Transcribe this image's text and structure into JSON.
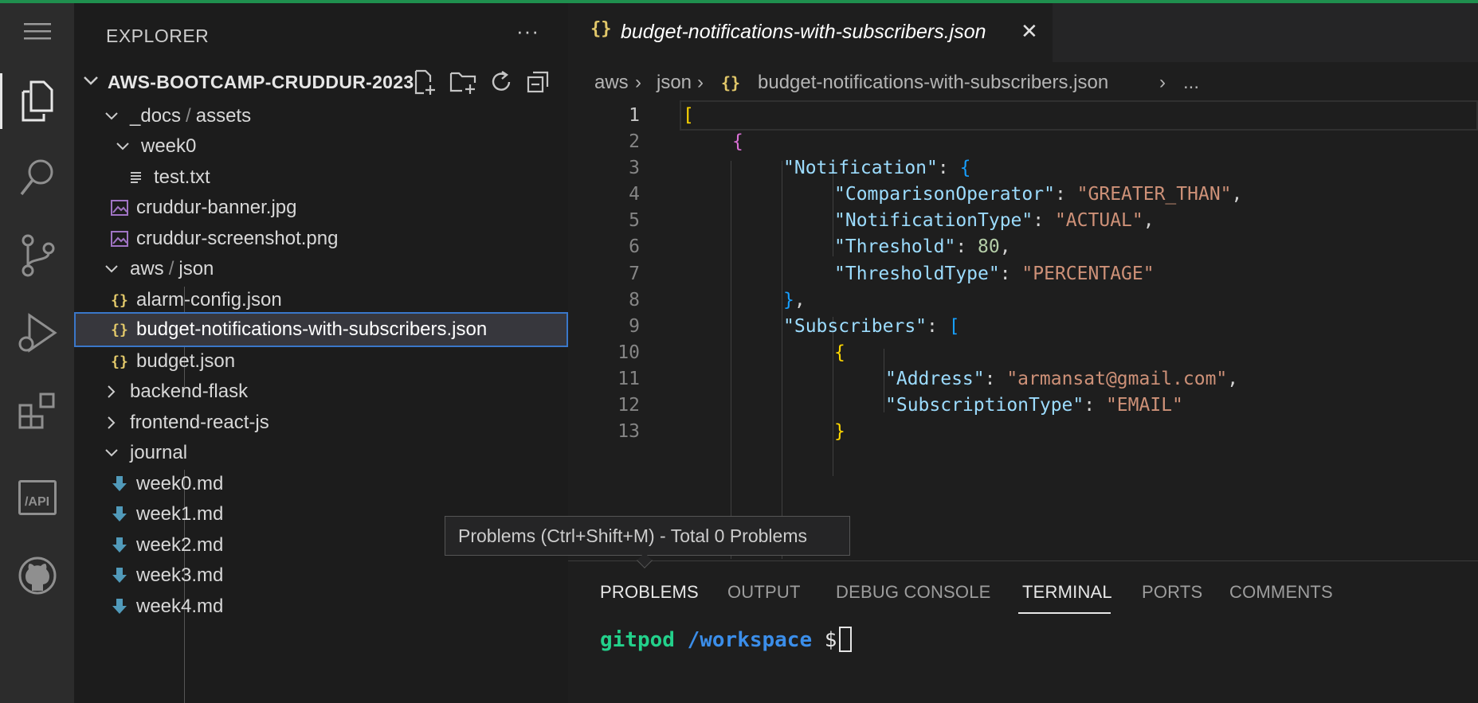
{
  "explorer": {
    "title": "EXPLORER",
    "more_label": "···",
    "folder_name": "AWS-BOOTCAMP-CRUDDUR-2023",
    "tree": [
      {
        "parts": [
          "_docs",
          "assets"
        ],
        "type": "folder-open"
      },
      {
        "label": "week0",
        "type": "folder-open"
      },
      {
        "label": "test.txt",
        "type": "text-file"
      },
      {
        "label": "cruddur-banner.jpg",
        "type": "image-file"
      },
      {
        "label": "cruddur-screenshot.png",
        "type": "image-file"
      },
      {
        "parts": [
          "aws",
          "json"
        ],
        "type": "folder-open"
      },
      {
        "label": "alarm-config.json",
        "type": "json-file"
      },
      {
        "label": "budget-notifications-with-subscribers.json",
        "type": "json-file",
        "selected": true
      },
      {
        "label": "budget.json",
        "type": "json-file"
      },
      {
        "label": "backend-flask",
        "type": "folder-closed"
      },
      {
        "label": "frontend-react-js",
        "type": "folder-closed"
      },
      {
        "label": "journal",
        "type": "folder-open"
      },
      {
        "label": "week0.md",
        "type": "markdown-file"
      },
      {
        "label": "week1.md",
        "type": "markdown-file"
      },
      {
        "label": "week2.md",
        "type": "markdown-file"
      },
      {
        "label": "week3.md",
        "type": "markdown-file"
      },
      {
        "label": "week4.md",
        "type": "markdown-file"
      }
    ]
  },
  "editor": {
    "tab": {
      "icon": "{}",
      "label": "budget-notifications-with-subscribers.json",
      "close": "✕"
    },
    "breadcrumb": [
      "aws",
      "json",
      "budget-notifications-with-subscribers.json",
      "..."
    ],
    "line_numbers": [
      "1",
      "2",
      "3",
      "4",
      "5",
      "6",
      "7",
      "8",
      "9",
      "10",
      "11",
      "12",
      "13"
    ],
    "code": {
      "l1": "[",
      "l2": "{",
      "l3_key": "\"Notification\"",
      "l3_punct": ": ",
      "l3_brace": "{",
      "l4_key": "\"ComparisonOperator\"",
      "l4_val": "\"GREATER_THAN\"",
      "l5_key": "\"NotificationType\"",
      "l5_val": "\"ACTUAL\"",
      "l6_key": "\"Threshold\"",
      "l6_val": "80",
      "l7_key": "\"ThresholdType\"",
      "l7_val": "\"PERCENTAGE\"",
      "l8": "}",
      "l9_key": "\"Subscribers\"",
      "l9_bracket": "[",
      "l10": "{",
      "l11_key": "\"Address\"",
      "l11_val": "\"armansat@gmail.com\"",
      "l12_key": "\"SubscriptionType\"",
      "l12_val": "\"EMAIL\"",
      "l13": "}"
    }
  },
  "panel": {
    "tabs": [
      "PROBLEMS",
      "OUTPUT",
      "DEBUG CONSOLE",
      "TERMINAL",
      "PORTS",
      "COMMENTS"
    ],
    "active_tab": "TERMINAL",
    "terminal": {
      "user": "gitpod",
      "path": "/workspace",
      "symbol": "$"
    }
  },
  "tooltip": {
    "text": "Problems (Ctrl+Shift+M) - Total 0 Problems"
  },
  "activity_bar": {
    "icons": [
      "menu-icon",
      "files-icon",
      "search-icon",
      "source-control-icon",
      "run-debug-icon",
      "extensions-icon",
      "api-icon",
      "github-icon"
    ],
    "api_label": "/API"
  },
  "colors": {
    "accent": "#3a77c9",
    "top_line": "#1f8f4e",
    "json_icon": "#e2c86a",
    "key": "#9cdcfe",
    "string": "#ce9178",
    "number": "#b5cea8"
  }
}
